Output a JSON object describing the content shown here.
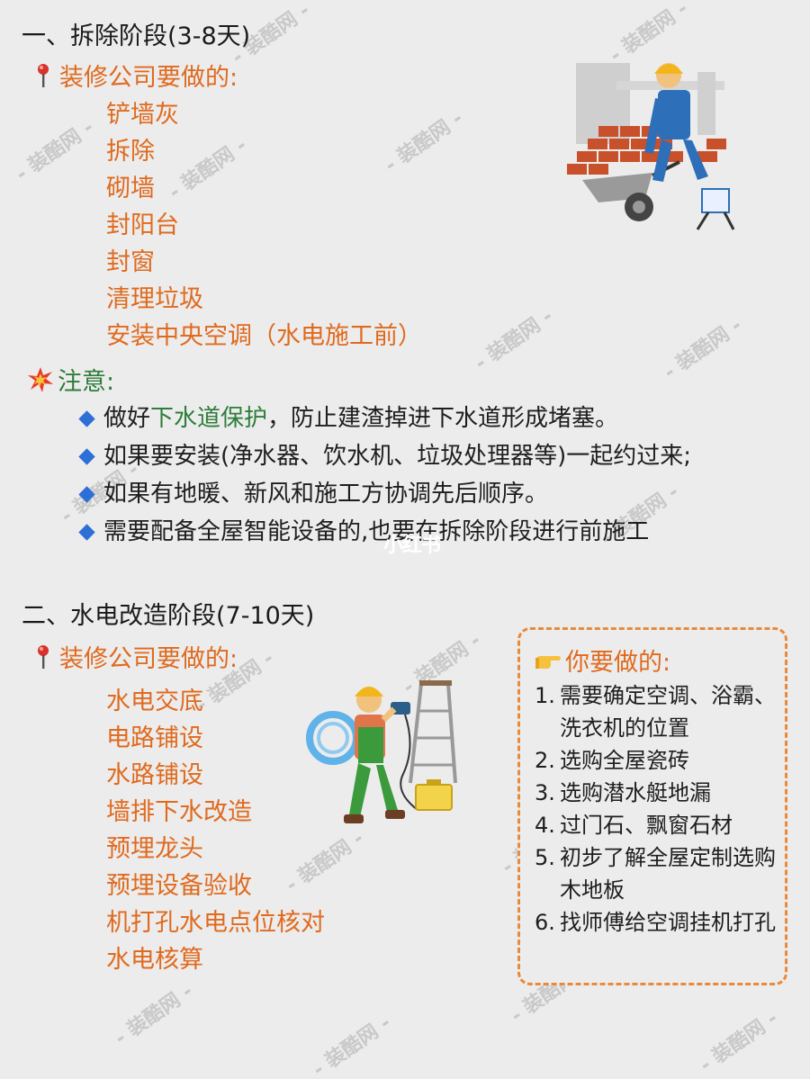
{
  "section1": {
    "title": "一、拆除阶段(3-8天)",
    "company_heading": "装修公司要做的:",
    "company_items": [
      "铲墙灰",
      "拆除",
      "砌墙",
      "封阳台",
      "封窗",
      "清理垃圾",
      "安装中央空调（水电施工前）"
    ],
    "note_heading": "注意:",
    "notes": [
      {
        "before": "做好",
        "highlight": "下水道保护",
        "after": "，防止建渣掉进下水道形成堵塞。"
      },
      {
        "before": "如果要安装(净水器、饮水机、垃圾处理器等)一起约过来;",
        "highlight": "",
        "after": ""
      },
      {
        "before": "如果有地暖、新风和施工方协调先后顺序。",
        "highlight": "",
        "after": ""
      },
      {
        "before": "需要配备全屋智能设备的,也要在拆除阶段进行前施工",
        "highlight": "",
        "after": ""
      }
    ]
  },
  "section2": {
    "title": "二、水电改造阶段(7-10天)",
    "company_heading": "装修公司要做的:",
    "company_items": [
      "水电交底",
      "电路铺设",
      "水路铺设",
      "墙排下水改造",
      "预埋龙头",
      "预埋设备验收",
      "机打孔水电点位核对",
      "水电核算"
    ],
    "you_heading": "你要做的:",
    "you_items": [
      {
        "num": "1.",
        "text": "需要确定空调、浴霸、洗衣机的位置"
      },
      {
        "num": "2.",
        "text": "选购全屋瓷砖"
      },
      {
        "num": "3.",
        "text": "选购潜水艇地漏"
      },
      {
        "num": "4.",
        "text": "过门石、飘窗石材"
      },
      {
        "num": "5.",
        "text": "初步了解全屋定制选购木地板"
      },
      {
        "num": "6.",
        "text": "找师傅给空调挂机打孔"
      }
    ]
  },
  "watermark": "- 装酷网 -",
  "logo": "小红书",
  "colors": {
    "orange": "#e06a1e",
    "green": "#2e7d3a",
    "blue": "#2d6fd6",
    "background": "#ececec"
  },
  "icons": [
    "pushpin-icon",
    "explosion-icon",
    "pointing-hand-icon",
    "diamond-bullet-icon",
    "worker-wheelbarrow-illustration",
    "electrician-illustration"
  ]
}
